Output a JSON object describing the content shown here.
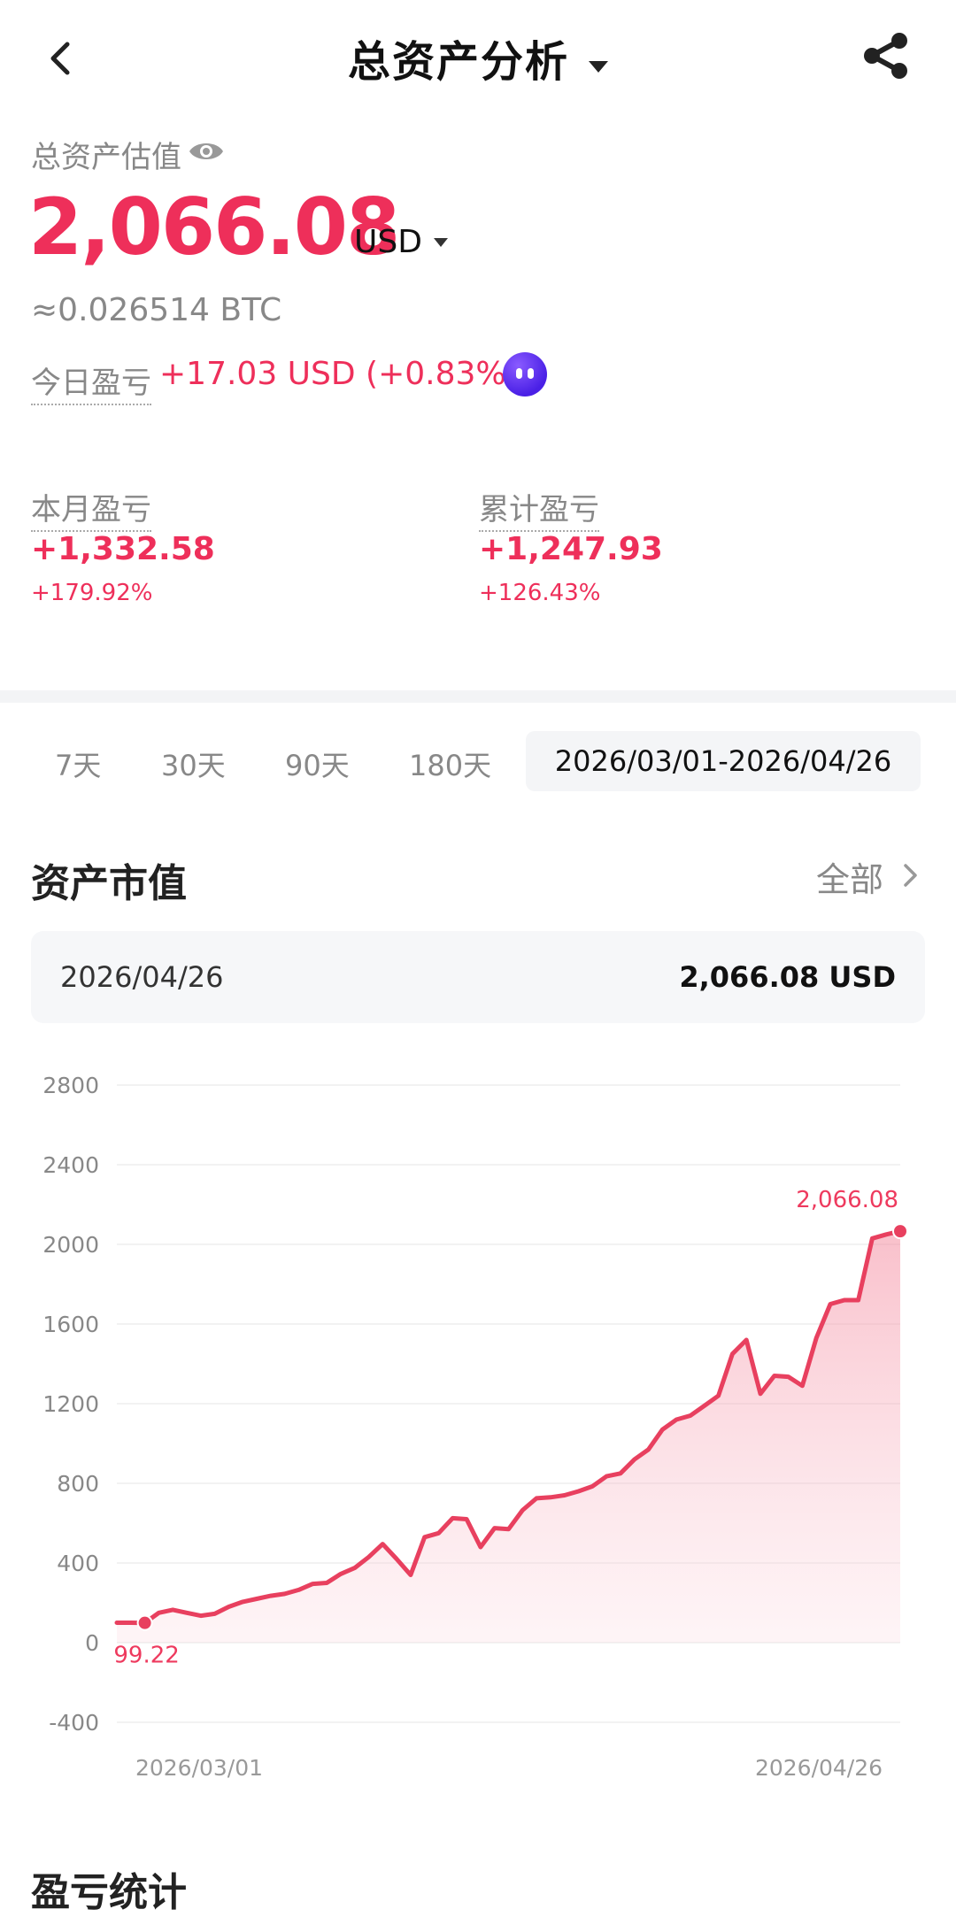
{
  "header": {
    "title": "总资产分析"
  },
  "summary": {
    "estimate_label": "总资产估值",
    "total_value": "2,066.08",
    "currency": "USD",
    "btc_equiv": "≈0.026514 BTC",
    "today_label": "今日盈亏",
    "today_value": "+17.03 USD (+0.83%)"
  },
  "pnl": {
    "month": {
      "label": "本月盈亏",
      "value": "+1,332.58",
      "pct": "+179.92%"
    },
    "cumulative": {
      "label": "累计盈亏",
      "value": "+1,247.93",
      "pct": "+126.43%"
    }
  },
  "tabs": {
    "t7": "7天",
    "t30": "30天",
    "t90": "90天",
    "t180": "180天",
    "custom": "2026/03/01-2026/04/26"
  },
  "section": {
    "title": "资产市值",
    "all_label": "全部"
  },
  "info": {
    "date": "2026/04/26",
    "value": "2,066.08 USD"
  },
  "colors": {
    "accent": "#ee2f5a",
    "line": "#e8405f"
  },
  "chart_data": {
    "type": "area",
    "x_start_label": "2026/03/01",
    "x_end_label": "2026/04/26",
    "yticks": [
      2800,
      2400,
      2000,
      1600,
      1200,
      800,
      400,
      0,
      -400
    ],
    "ylim": [
      -400,
      2800
    ],
    "start_label": "99.22",
    "end_label": "2,066.08",
    "values": [
      100,
      100,
      99.22,
      150,
      165,
      150,
      135,
      145,
      180,
      205,
      220,
      235,
      245,
      265,
      295,
      300,
      345,
      375,
      430,
      495,
      420,
      340,
      530,
      550,
      625,
      620,
      480,
      575,
      570,
      665,
      725,
      730,
      740,
      760,
      785,
      835,
      850,
      920,
      970,
      1070,
      1120,
      1140,
      1190,
      1240,
      1450,
      1520,
      1250,
      1340,
      1335,
      1290,
      1530,
      1700,
      1720,
      1720,
      2030,
      2050,
      2066.08
    ]
  },
  "bottom": {
    "title": "盈亏统计"
  }
}
